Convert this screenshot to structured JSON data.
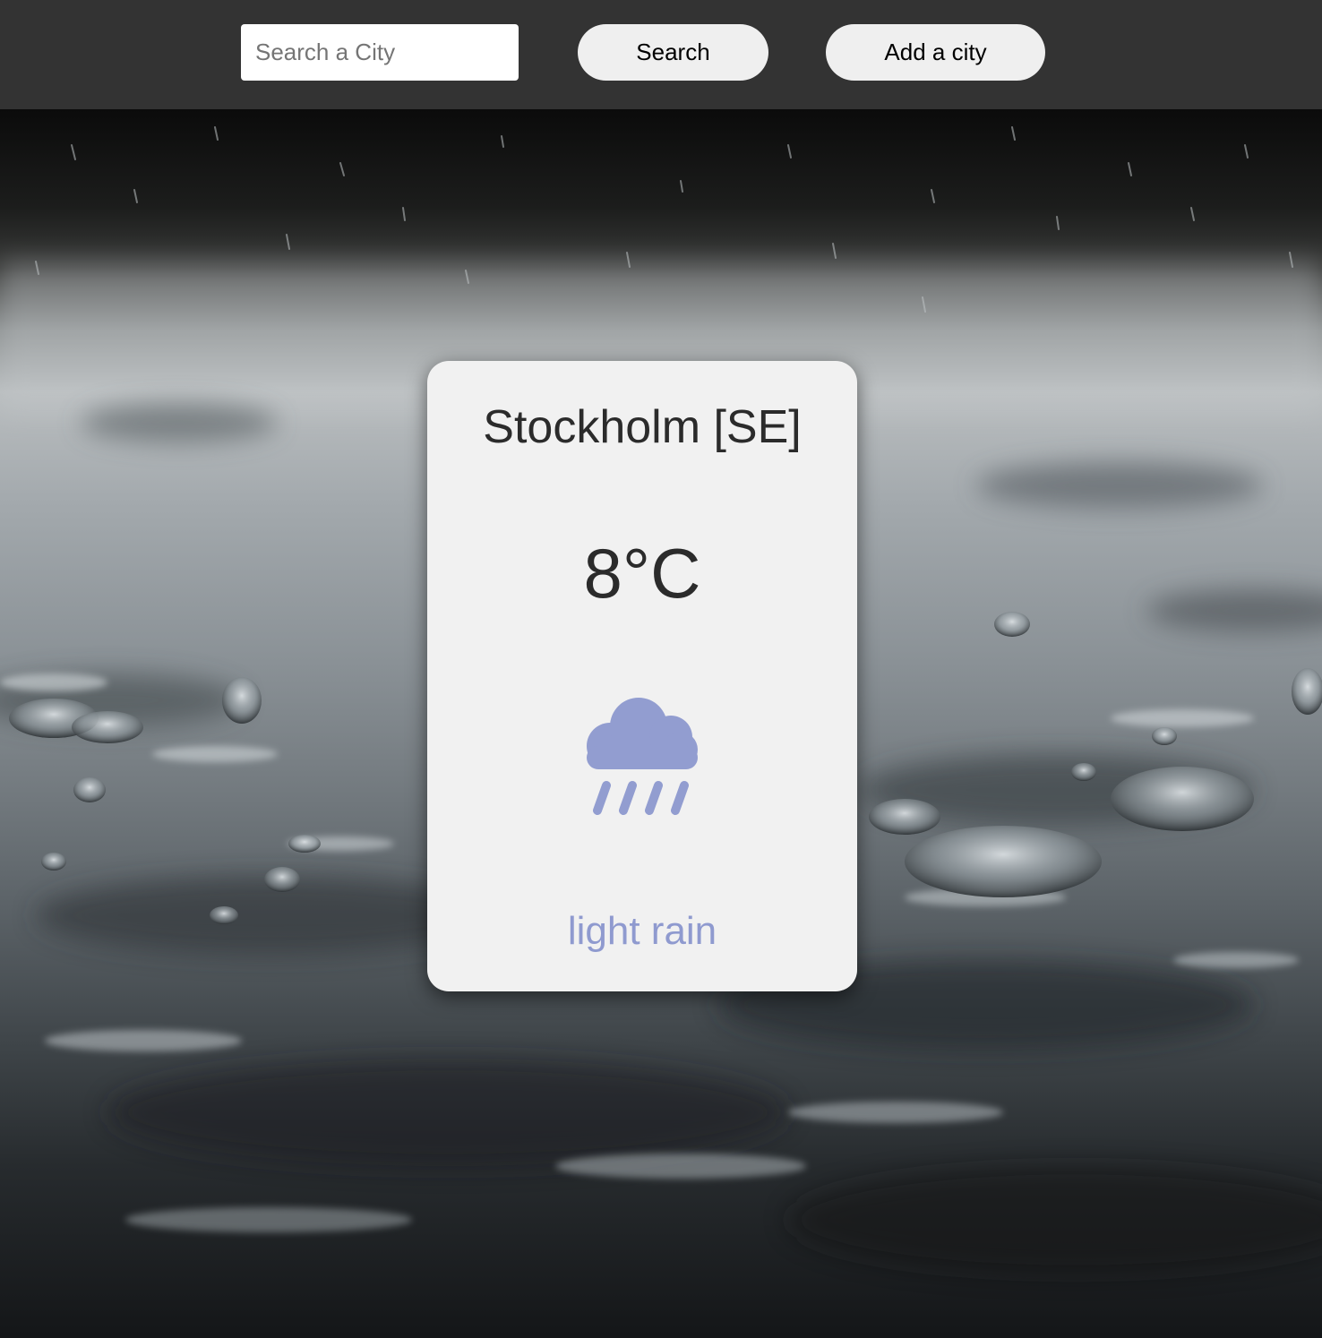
{
  "search": {
    "placeholder": "Search a City",
    "button_label": "Search",
    "add_label": "Add a city"
  },
  "weather": {
    "city": "Stockholm [SE]",
    "temperature": "8°C",
    "description": "light rain",
    "icon": "rain-cloud-icon",
    "icon_color": "#929dd0"
  },
  "background": {
    "theme": "rain"
  }
}
